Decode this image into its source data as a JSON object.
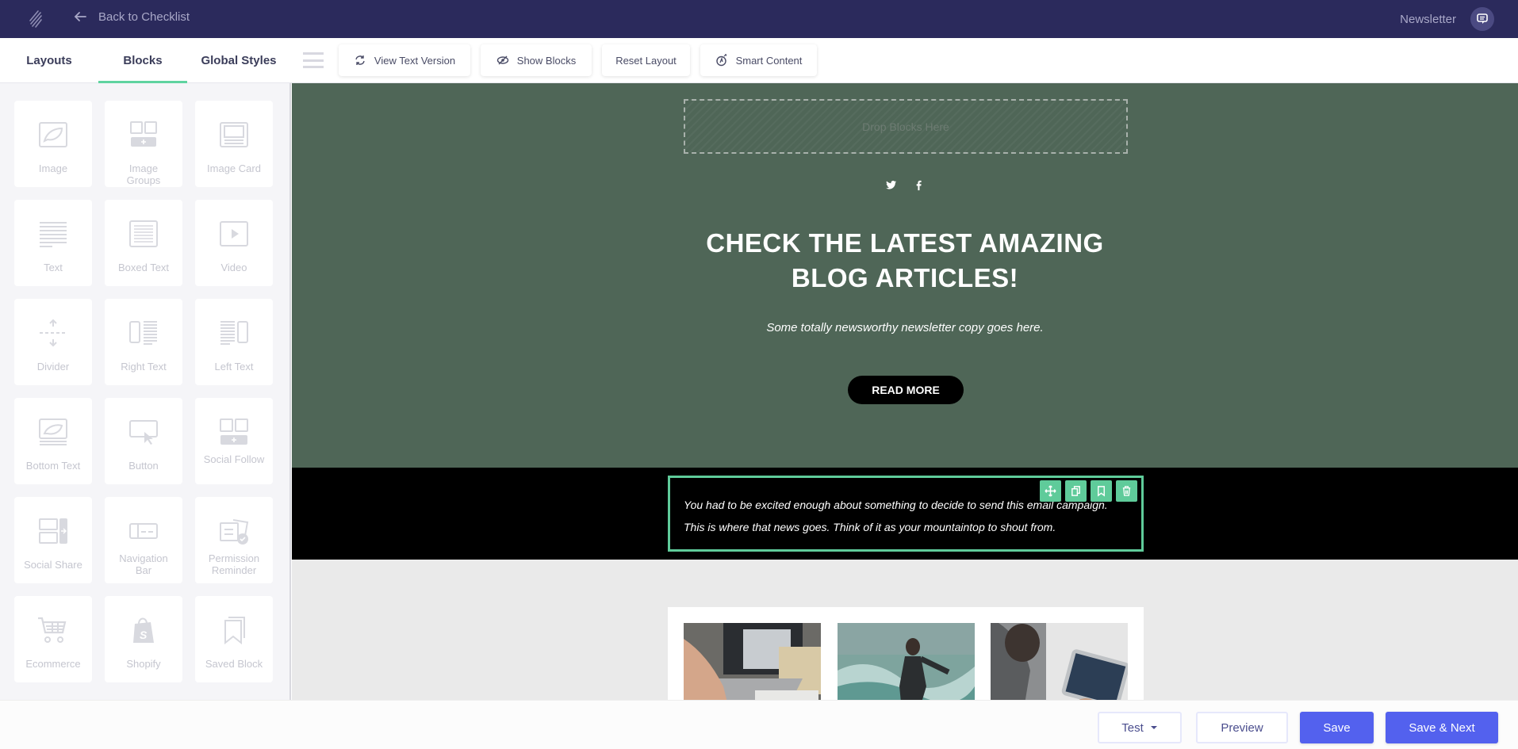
{
  "topbar": {
    "logo_icon": "brand-logo-stripes",
    "back_label": "Back to Checklist",
    "campaign_name": "Newsletter",
    "chat_icon": "chat-bubble-icon"
  },
  "toolbar": {
    "tabs": [
      {
        "label": "Layouts",
        "active": false
      },
      {
        "label": "Blocks",
        "active": true
      },
      {
        "label": "Global Styles",
        "active": false
      }
    ],
    "buttons": [
      {
        "label": "View Text Version",
        "icon": "refresh-icon"
      },
      {
        "label": "Show Blocks",
        "icon": "eye-slash-icon"
      },
      {
        "label": "Reset Layout",
        "icon": ""
      },
      {
        "label": "Smart Content",
        "icon": "smart-content-icon"
      }
    ]
  },
  "sidebar": {
    "blocks": [
      {
        "label": "Image",
        "icon": "image-icon"
      },
      {
        "label": "Image Groups",
        "icon": "image-groups-icon"
      },
      {
        "label": "Image Card",
        "icon": "image-card-icon"
      },
      {
        "label": "Text",
        "icon": "text-icon"
      },
      {
        "label": "Boxed Text",
        "icon": "boxed-text-icon"
      },
      {
        "label": "Video",
        "icon": "video-icon"
      },
      {
        "label": "Divider",
        "icon": "divider-icon"
      },
      {
        "label": "Right Text",
        "icon": "right-text-icon"
      },
      {
        "label": "Left Text",
        "icon": "left-text-icon"
      },
      {
        "label": "Bottom Text",
        "icon": "bottom-text-icon"
      },
      {
        "label": "Button",
        "icon": "button-icon"
      },
      {
        "label": "Social Follow",
        "icon": "social-follow-icon"
      },
      {
        "label": "Social Share",
        "icon": "social-share-icon"
      },
      {
        "label": "Navigation Bar",
        "icon": "navigation-bar-icon"
      },
      {
        "label": "Permission Reminder",
        "icon": "permission-reminder-icon"
      },
      {
        "label": "Ecommerce",
        "icon": "cart-icon"
      },
      {
        "label": "Shopify",
        "icon": "shopify-icon"
      },
      {
        "label": "Saved Block",
        "icon": "bookmark-icon"
      }
    ]
  },
  "canvas": {
    "drop_zone_label": "Drop Blocks Here",
    "social_icons": [
      "twitter-icon",
      "facebook-icon"
    ],
    "headline_line1": "CHECK THE LATEST AMAZING",
    "headline_line2": "BLOG ARTICLES!",
    "copy": "Some totally newsworthy newsletter copy goes here.",
    "cta_label": "READ MORE",
    "selected_text_line1": "You had to be excited enough about something to decide to send this email campaign.",
    "selected_text_line2": "This is where that news goes. Think of it as your mountaintop to shout from.",
    "block_tools": [
      "move-icon",
      "duplicate-icon",
      "save-block-icon",
      "delete-icon"
    ],
    "photos": [
      "laptop-notebook-photo",
      "surfer-photo",
      "tablet-reading-photo"
    ],
    "colors": {
      "hero_bg": "#4f6657",
      "dark_band": "#000000",
      "selection": "#5fcb9a",
      "canvas_bg": "#eaeaea"
    }
  },
  "footer": {
    "test_label": "Test",
    "preview_label": "Preview",
    "save_label": "Save",
    "save_next_label": "Save & Next",
    "primary_color": "#5361ee"
  },
  "theme": {
    "topbar_bg": "#2b2a5c",
    "accent_green": "#5fd3a0"
  }
}
